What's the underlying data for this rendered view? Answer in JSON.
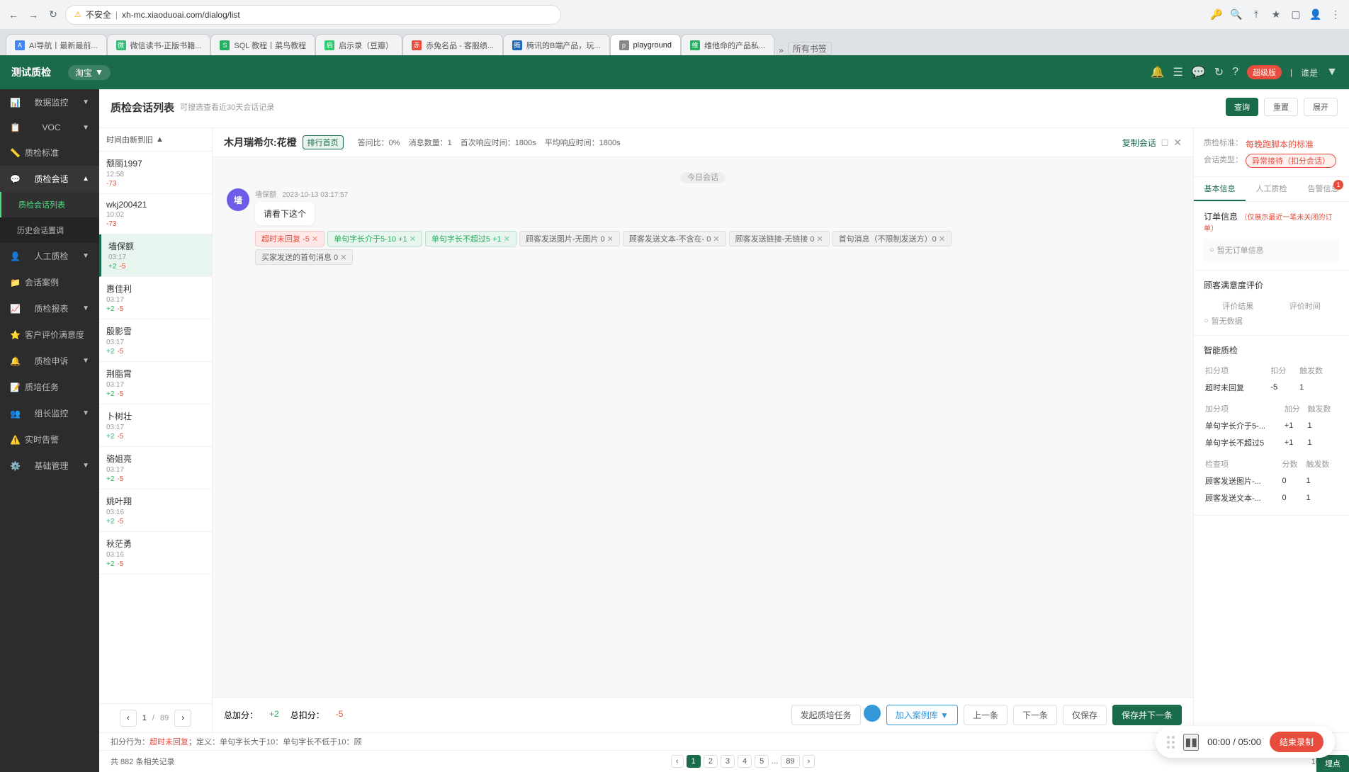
{
  "browser": {
    "url": "xh-mc.xiaoduoai.com/dialog/list",
    "security_warning": "不安全",
    "tabs": [
      {
        "label": "AI导航丨最新最前...",
        "favicon_color": "#4285f4",
        "active": false
      },
      {
        "label": "微信读书-正版书籍...",
        "favicon_color": "#3b7",
        "active": false
      },
      {
        "label": "SQL 教程丨菜鸟教程",
        "favicon_color": "#27ae60",
        "active": false
      },
      {
        "label": "启示录（豆瓣）",
        "favicon_color": "#2ecc71",
        "active": false
      },
      {
        "label": "赤兔名品 - 客服绩...",
        "favicon_color": "#e74c3c",
        "active": false
      },
      {
        "label": "腾讯的B端产品，玩...",
        "favicon_color": "#1e6bbd",
        "active": false
      },
      {
        "label": "playground",
        "favicon_color": "#888",
        "active": false
      },
      {
        "label": "维他命的产品私...",
        "favicon_color": "#27ae60",
        "active": false
      }
    ]
  },
  "app": {
    "title": "测试质检",
    "platform": "淘宝",
    "vip_badge": "超级版",
    "user": "谁是",
    "header_icons": [
      "bell",
      "menu",
      "comment",
      "refresh",
      "help"
    ]
  },
  "sidebar": {
    "items": [
      {
        "label": "数据监控",
        "icon": "📊",
        "has_sub": true,
        "active": false
      },
      {
        "label": "VOC",
        "icon": "📋",
        "has_sub": true,
        "active": false
      },
      {
        "label": "质检标准",
        "icon": "📏",
        "has_sub": false,
        "active": false
      },
      {
        "label": "质检会话",
        "icon": "💬",
        "has_sub": true,
        "active": true
      },
      {
        "label": "质检会话列表",
        "sub": true,
        "active": true
      },
      {
        "label": "历史会话置调",
        "sub": true,
        "active": false
      },
      {
        "label": "人工质检",
        "icon": "👤",
        "has_sub": true,
        "active": false
      },
      {
        "label": "会话案例",
        "icon": "📁",
        "has_sub": false,
        "active": false
      },
      {
        "label": "质检报表",
        "icon": "📈",
        "has_sub": true,
        "active": false
      },
      {
        "label": "客户评价满意度",
        "icon": "⭐",
        "has_sub": false,
        "active": false
      },
      {
        "label": "质检申诉",
        "icon": "🔔",
        "has_sub": true,
        "active": false
      },
      {
        "label": "质培任务",
        "icon": "📝",
        "has_sub": false,
        "active": false
      },
      {
        "label": "组长监控",
        "icon": "👥",
        "has_sub": true,
        "active": false
      },
      {
        "label": "实时告警",
        "icon": "⚠️",
        "has_sub": false,
        "active": false
      },
      {
        "label": "基础管理",
        "icon": "⚙️",
        "has_sub": true,
        "active": false
      }
    ]
  },
  "page": {
    "title": "质检会话列表",
    "subtitle": "可搜选查看近30天会话记录"
  },
  "conv_list": {
    "sort_label": "时间由新到旧",
    "items": [
      {
        "name": "颓丽1997",
        "time": "12:58",
        "score_pos": null,
        "score_neg": "-73",
        "active": false
      },
      {
        "name": "wkj200421",
        "time": "10:02",
        "score_pos": null,
        "score_neg": "-73",
        "active": false
      },
      {
        "name": "墙保额",
        "time": "03:17",
        "score_pos": "+2",
        "score_neg": "-5",
        "active": true
      },
      {
        "name": "惠佳利",
        "time": "03:17",
        "score_pos": "+2",
        "score_neg": "-5",
        "active": false
      },
      {
        "name": "殷影雪",
        "time": "03:17",
        "score_pos": "+2",
        "score_neg": "-5",
        "active": false
      },
      {
        "name": "荆脂霄",
        "time": "03:17",
        "score_pos": "+2",
        "score_neg": "-5",
        "active": false
      },
      {
        "name": "卜树壮",
        "time": "03:17",
        "score_pos": "+2",
        "score_neg": "-5",
        "active": false
      },
      {
        "name": "骆姐亮",
        "time": "03:17",
        "score_pos": "+2",
        "score_neg": "-5",
        "active": false
      },
      {
        "name": "姚叶翔",
        "time": "03:16",
        "score_pos": "+2",
        "score_neg": "-5",
        "active": false
      },
      {
        "name": "秋茫勇",
        "time": "03:16",
        "score_pos": "+2",
        "score_neg": "-5",
        "active": false
      }
    ],
    "current_page": 1,
    "total_pages": 89
  },
  "dialog": {
    "agent_name": "木月瑞希尔:花橙",
    "badge": "排行首页",
    "answer_rate": "答问比：0%",
    "msg_count": "消息数量：1",
    "first_response": "首次响应时间：1800s",
    "avg_response": "平均响应时间：1800s",
    "copy_label": "复制会话",
    "date_divider": "今日会话",
    "message": {
      "avatar_text": "墙",
      "avatar_bg": "#6c5ce7",
      "sender": "墙保额",
      "time": "2023-10-13 03:17:57",
      "text": "请看下这个"
    },
    "tags": [
      {
        "text": "超时未回复 -5",
        "style": "red",
        "has_close": true
      },
      {
        "text": "单句字长介于5-10 +1",
        "style": "green",
        "has_close": true
      },
      {
        "text": "单句字长不超过5 +1",
        "style": "green",
        "has_close": true
      },
      {
        "text": "顾客发送图片-无图片 0",
        "style": "gray",
        "has_close": true
      },
      {
        "text": "顾客发送文本-不含在- 0",
        "style": "gray",
        "has_close": true
      },
      {
        "text": "顾客发送链接-无链接 0",
        "style": "gray",
        "has_close": true
      },
      {
        "text": "首句消息（不限制发送方）0",
        "style": "gray",
        "has_close": true
      },
      {
        "text": "买家发送的首句消息 0",
        "style": "gray",
        "has_close": true
      }
    ],
    "footer": {
      "total_add": "总加分：+2",
      "total_deduct": "总扣分：-5",
      "btn_task": "发起质培任务",
      "btn_add_case": "加入案例库",
      "btn_prev": "上一条",
      "btn_next": "下一条",
      "btn_only_save": "仅保存",
      "btn_save_next": "保存并下一条"
    }
  },
  "right_panel": {
    "quality_standard_label": "质检标准：",
    "quality_standard_value": "每晚跑脚本的标准",
    "conv_type_label": "会话类型：",
    "conv_type_value": "异常接待（扣分会话）",
    "tabs": [
      {
        "label": "基本信息",
        "active": true
      },
      {
        "label": "人工质检",
        "active": false
      },
      {
        "label": "告警信息",
        "badge": "1",
        "active": false
      }
    ],
    "order_info": {
      "title": "订单信息",
      "subtitle": "（仅展示最近一笔未关闭的订单）",
      "no_order": "暂无订单信息"
    },
    "satisfaction": {
      "title": "顾客满意度评价",
      "col_result": "评价结果",
      "col_time": "评价时间",
      "no_data": "暂无数据"
    },
    "smart_check": {
      "title": "智能质检",
      "deduct_col1": "扣分项",
      "deduct_col2": "扣分",
      "deduct_col3": "触发数",
      "deduct_items": [
        {
          "name": "超时未回复",
          "score": "-5",
          "count": "1"
        }
      ],
      "add_col1": "加分项",
      "add_col2": "加分",
      "add_col3": "触发数",
      "add_items": [
        {
          "name": "单句字长介于5-...",
          "score": "+1",
          "count": "1"
        },
        {
          "name": "单句字长不超过5",
          "score": "+1",
          "count": "1"
        }
      ],
      "check_col1": "检查项",
      "check_col2": "分数",
      "check_col3": "触发数",
      "check_items": [
        {
          "name": "顾客发送图片-...",
          "score": "0",
          "count": "1"
        },
        {
          "name": "顾客发送文本-...",
          "score": "0",
          "count": "1"
        }
      ]
    }
  },
  "bottom_info": {
    "text": "扣分行为：超时未回复；定义：单句字长大于10；单句字长不低于10：顾"
  },
  "page_footer": {
    "total_count": "共 882 条相关记录",
    "pages": [
      "1",
      "2",
      "3",
      "4",
      "5",
      "...",
      "89"
    ],
    "per_page": "10条/页",
    "current": "1"
  },
  "recording": {
    "time": "00:00 / 05:00",
    "end_label": "结束录制",
    "tip_label": "埋点"
  }
}
